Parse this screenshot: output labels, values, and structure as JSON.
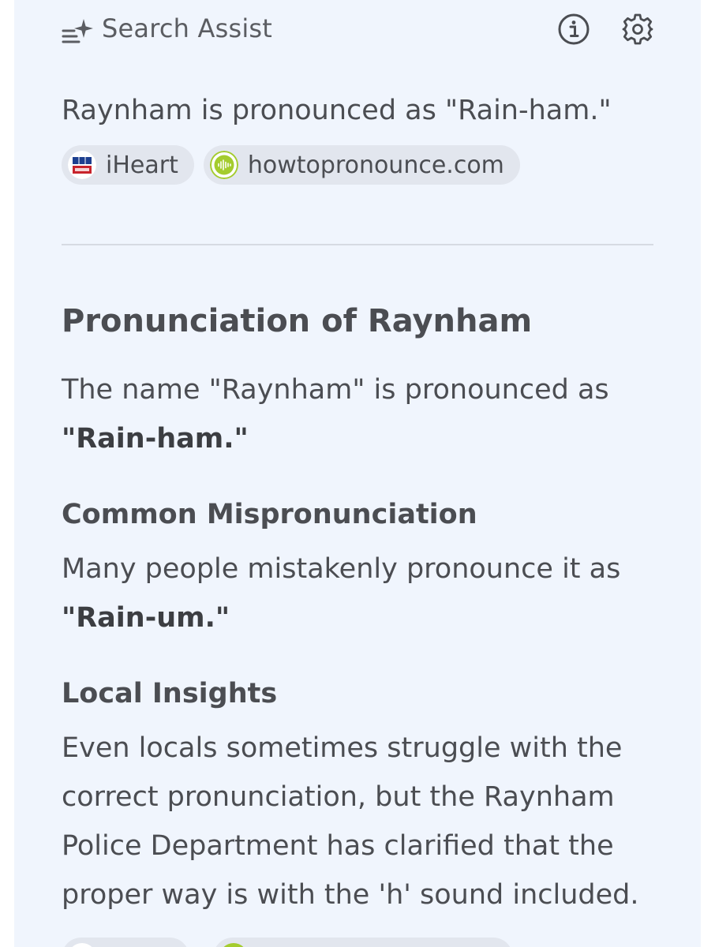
{
  "header": {
    "title": "Search Assist",
    "icons": [
      "sparkle-list-icon",
      "info-icon",
      "gear-icon"
    ]
  },
  "summary": {
    "text": "Raynham is pronounced as \"Rain-ham.\"",
    "sources": [
      {
        "label": "iHeart",
        "icon": "wbz-logo-icon"
      },
      {
        "label": "howtopronounce.com",
        "icon": "audio-wave-icon"
      }
    ]
  },
  "article": {
    "heading": "Pronunciation of Raynham",
    "intro_text": "The name \"Raynham\" is pronounced as",
    "intro_bold": "\"Rain-ham.\"",
    "sections": [
      {
        "heading": "Common Mispronunciation",
        "text": "Many people mistakenly pronounce it as",
        "bold": "\"Rain-um.\""
      },
      {
        "heading": "Local Insights",
        "lines": [
          "Even locals sometimes struggle with the",
          "correct pronunciation, but the Raynham",
          "Police Department has clarified that the",
          "proper way is with the 'h' sound included."
        ]
      }
    ]
  },
  "colors": {
    "panel_bg": "#f0f5fd",
    "text": "#4b4d52",
    "chip_bg": "#e2e6ee",
    "wbz_red": "#c8232c",
    "wbz_blue": "#1d3f8f",
    "wave_green": "#a4cc2e"
  }
}
